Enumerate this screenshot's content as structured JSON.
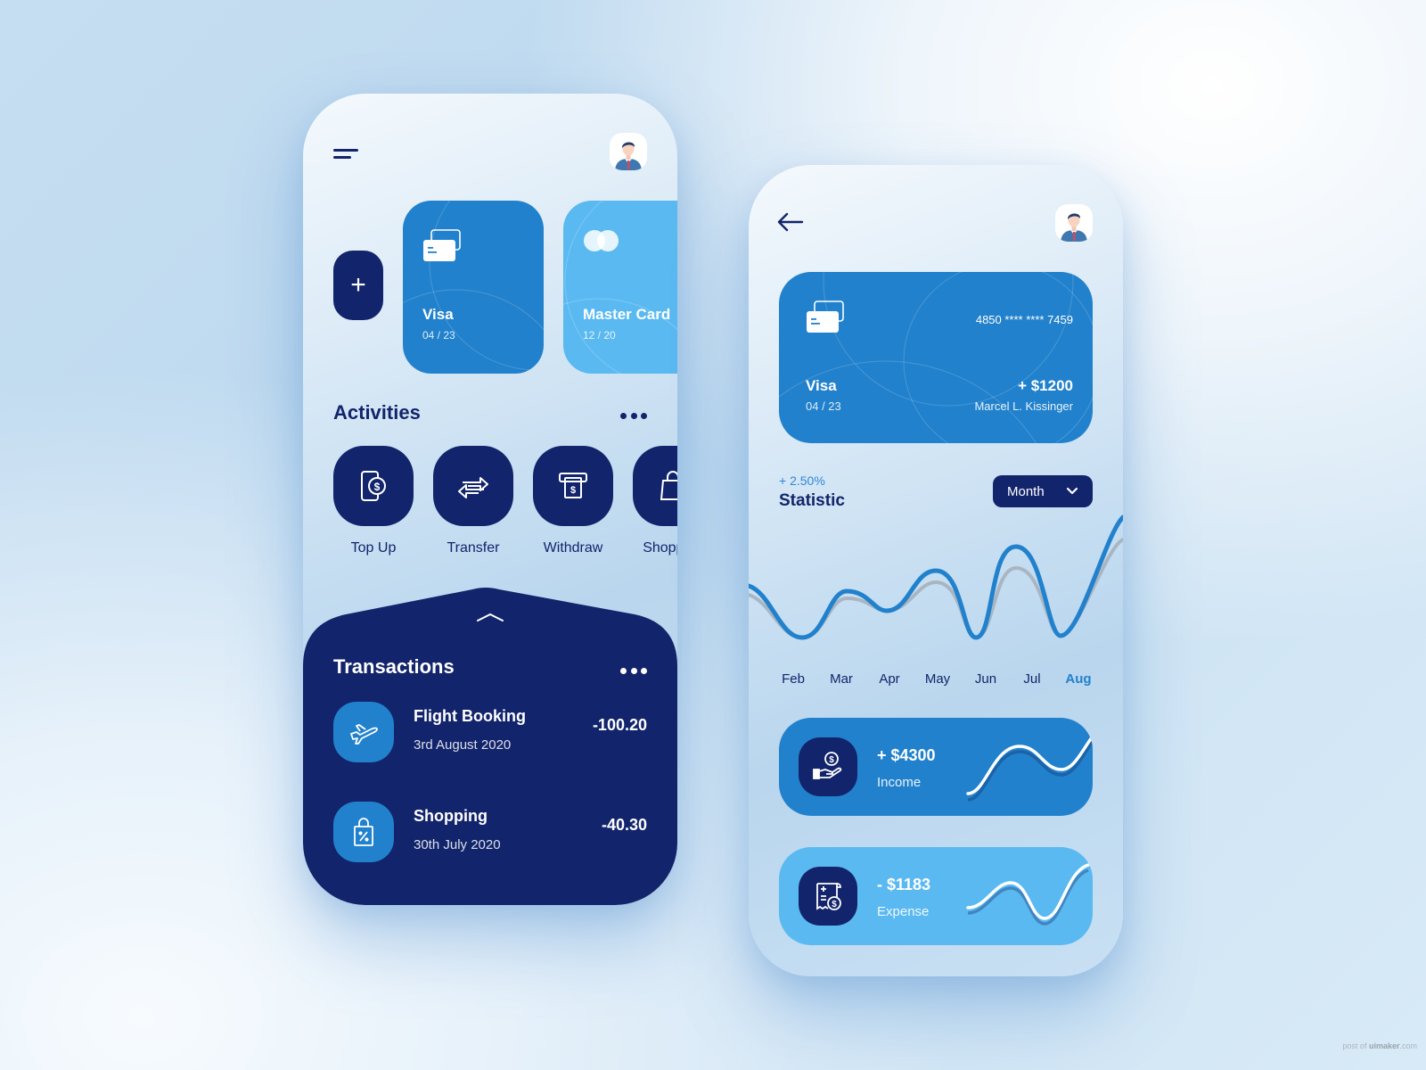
{
  "left_screen": {
    "cards": [
      {
        "name": "Visa",
        "expiry": "04 / 23"
      },
      {
        "name": "Master Card",
        "expiry": "12 / 20"
      }
    ],
    "add_card_label": "+",
    "activities": {
      "title": "Activities",
      "items": [
        {
          "label": "Top Up",
          "icon": "phone-dollar-icon"
        },
        {
          "label": "Transfer",
          "icon": "transfer-arrows-icon"
        },
        {
          "label": "Withdraw",
          "icon": "atm-withdraw-icon"
        },
        {
          "label": "Shopping",
          "icon": "shopping-bag-icon"
        }
      ]
    },
    "transactions": {
      "title": "Transactions",
      "items": [
        {
          "name": "Flight Booking",
          "date": "3rd August 2020",
          "amount": "-100.20",
          "icon": "airplane-icon"
        },
        {
          "name": "Shopping",
          "date": "30th July 2020",
          "amount": "-40.30",
          "icon": "shopping-bag-percent-icon"
        }
      ]
    }
  },
  "right_screen": {
    "card": {
      "name": "Visa",
      "expiry": "04 / 23",
      "number": "4850 **** **** 7459",
      "balance": "+ $1200",
      "holder": "Marcel L. Kissinger"
    },
    "statistic": {
      "change": "+ 2.50%",
      "title": "Statistic",
      "period_select": "Month",
      "months": [
        "Feb",
        "Mar",
        "Apr",
        "May",
        "Jun",
        "Jul",
        "Aug"
      ],
      "active_month": "Aug"
    },
    "income": {
      "amount": "+ $4300",
      "label": "Income"
    },
    "expense": {
      "amount": "- $1183",
      "label": "Expense"
    }
  },
  "colors": {
    "navy": "#12246b",
    "primary_blue": "#2181cc",
    "light_blue": "#5ab9f1",
    "accent_text": "#2f88d6"
  },
  "watermark": {
    "prefix": "post of ",
    "brand": "uimaker",
    "suffix": ".com"
  }
}
